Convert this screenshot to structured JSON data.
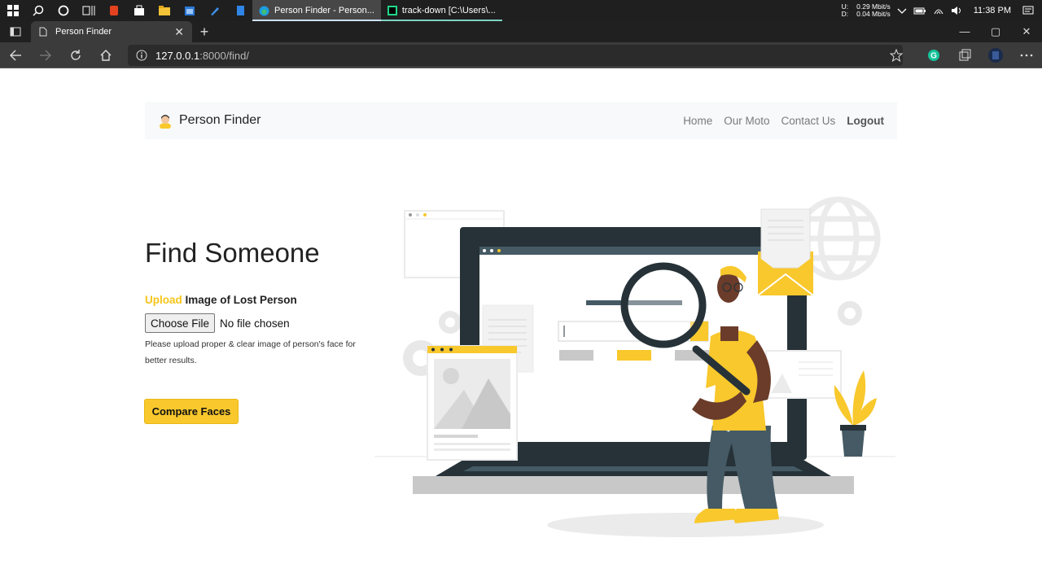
{
  "taskbar": {
    "apps": [
      {
        "label": "Person Finder - Person...",
        "icon": "edge-icon"
      },
      {
        "label": "track-down [C:\\Users\\...",
        "icon": "pycharm-icon"
      }
    ],
    "network": {
      "up_label": "U:",
      "up_value": "0.29 Mbit/s",
      "down_label": "D:",
      "down_value": "0.04 Mbit/s"
    },
    "clock": "11:38 PM"
  },
  "browser": {
    "tab_title": "Person Finder",
    "url_host": "127.0.0.1",
    "url_rest": ":8000/find/"
  },
  "navbar": {
    "brand": "Person Finder",
    "links": [
      "Home",
      "Our Moto",
      "Contact Us"
    ],
    "logout": "Logout"
  },
  "main": {
    "title": "Find Someone",
    "upload_highlight": "Upload",
    "upload_label": " Image of Lost Person",
    "choose_file": "Choose File",
    "no_file": "No file chosen",
    "hint": "Please upload proper & clear image of person's face for better results.",
    "compare_button": "Compare Faces"
  },
  "colors": {
    "accent": "#f8c82c",
    "dark": "#263238",
    "navbar_bg": "#f8f9fa"
  }
}
